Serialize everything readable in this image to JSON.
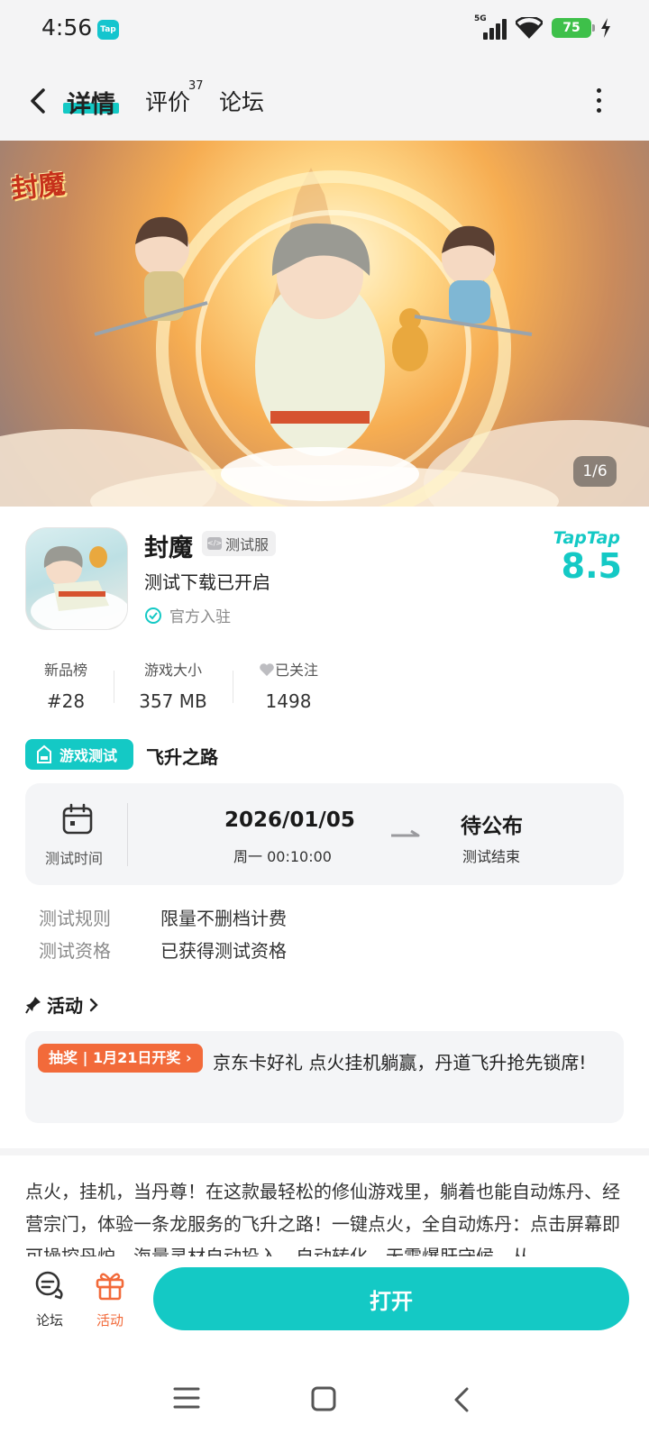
{
  "status_bar": {
    "time": "4:56",
    "app_badge": "Tap",
    "network": "5G",
    "battery": "75"
  },
  "header": {
    "tabs": [
      {
        "label": "详情"
      },
      {
        "label": "评价",
        "count": "37"
      },
      {
        "label": "论坛"
      }
    ]
  },
  "hero": {
    "logo_text": "封魔",
    "counter": "1/6"
  },
  "app": {
    "name": "封魔",
    "badge": "测试服",
    "subtitle": "测试下载已开启",
    "official": "官方入驻",
    "rating_brand": "TapTap",
    "rating": "8.5"
  },
  "stats": [
    {
      "label": "新品榜",
      "value": "#28"
    },
    {
      "label": "游戏大小",
      "value": "357 MB"
    },
    {
      "label": "已关注",
      "value": "1498"
    }
  ],
  "test": {
    "tag": "游戏测试",
    "title": "飞升之路",
    "time_label": "测试时间",
    "start_date": "2026/01/05",
    "start_time": "周一  00:10:00",
    "end_value": "待公布",
    "end_label": "测试结束",
    "rules": [
      {
        "label": "测试规则",
        "value": "限量不删档计费"
      },
      {
        "label": "测试资格",
        "value": "已获得测试资格"
      }
    ]
  },
  "activity": {
    "title": "活动",
    "badge": "抽奖 | 1月21日开奖 ›",
    "text": "京东卡好礼 点火挂机躺赢，丹道飞升抢先锁席!"
  },
  "description": "点火，挂机，当丹尊！在这款最轻松的修仙游戏里，躺着也能自动炼丹、经营宗门，体验一条龙服务的飞升之路！一键点火，全自动炼丹：点击屏幕即可操控丹炉，海量灵材自动投入、自动转化。无需爆肝守候，从…",
  "bottom_bar": {
    "forum": "论坛",
    "activity": "活动",
    "open": "打开"
  },
  "colors": {
    "accent": "#14c9c5",
    "orange": "#f26a3a",
    "card_bg": "#f4f5f7"
  }
}
